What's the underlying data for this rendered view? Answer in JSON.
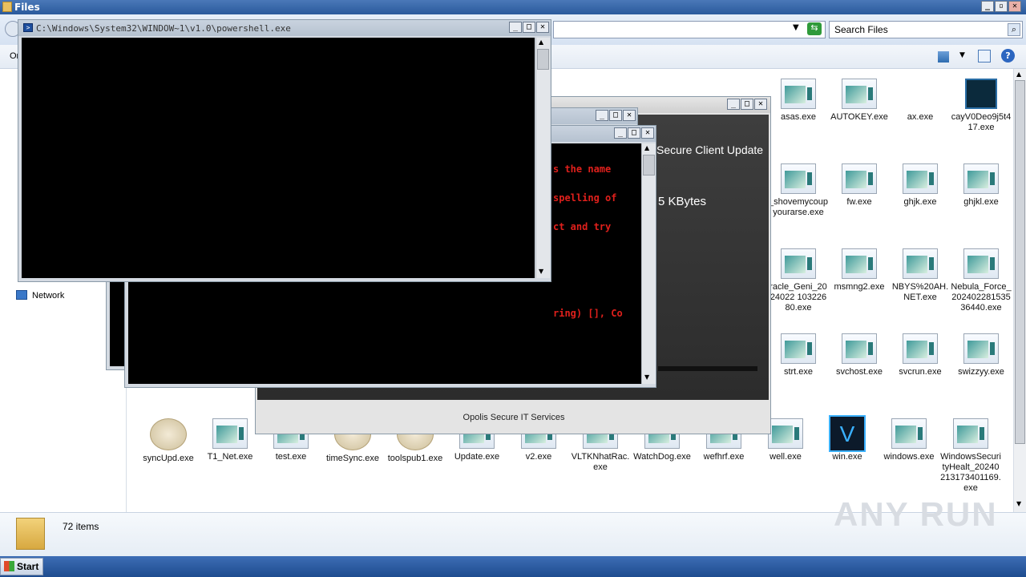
{
  "explorer": {
    "title": "Files",
    "search_placeholder": "Search Files",
    "address_value": "",
    "toolbar_left": "Or",
    "nav_network": "Network",
    "status_count": "72 items",
    "watermark": "ANY RUN"
  },
  "files": [
    {
      "name": "asas.exe",
      "icon": "exe"
    },
    {
      "name": "AUTOKEY.exe",
      "icon": "exe"
    },
    {
      "name": "ax.exe",
      "icon": "none"
    },
    {
      "name": "cayV0Deo9j5t417.exe",
      "icon": "terminal"
    },
    {
      "name": "_shovemycoupyourarse.exe",
      "icon": "exe"
    },
    {
      "name": "fw.exe",
      "icon": "exe"
    },
    {
      "name": "ghjk.exe",
      "icon": "exe"
    },
    {
      "name": "ghjkl.exe",
      "icon": "exe"
    },
    {
      "name": "racle_Geni_2024022 10322680.exe",
      "icon": "exe"
    },
    {
      "name": "msmng2.exe",
      "icon": "exe"
    },
    {
      "name": "NBYS%20AH.NET.exe",
      "icon": "exe"
    },
    {
      "name": "Nebula_Force_20240228153536440.exe",
      "icon": "exe"
    },
    {
      "name": "strt.exe",
      "icon": "exe"
    },
    {
      "name": "svchost.exe",
      "icon": "exe"
    },
    {
      "name": "svcrun.exe",
      "icon": "exe"
    },
    {
      "name": "swizzyy.exe",
      "icon": "exe"
    },
    {
      "name": "syncUpd.exe",
      "icon": "bubble"
    },
    {
      "name": "T1_Net.exe",
      "icon": "exe"
    },
    {
      "name": "test.exe",
      "icon": "exe"
    },
    {
      "name": "timeSync.exe",
      "icon": "bubble"
    },
    {
      "name": "toolspub1.exe",
      "icon": "bubble"
    },
    {
      "name": "Update.exe",
      "icon": "exe"
    },
    {
      "name": "v2.exe",
      "icon": "exe"
    },
    {
      "name": "VLTKNhatRac.exe",
      "icon": "exe"
    },
    {
      "name": "WatchDog.exe",
      "icon": "exe"
    },
    {
      "name": "wefhrf.exe",
      "icon": "exe"
    },
    {
      "name": "well.exe",
      "icon": "exe"
    },
    {
      "name": "win.exe",
      "icon": "v-logo"
    },
    {
      "name": "windows.exe",
      "icon": "exe"
    },
    {
      "name": "WindowsSecurityHealt_20240213173401169.exe",
      "icon": "exe"
    }
  ],
  "powershell": {
    "title": "C:\\Windows\\System32\\WINDOW~1\\v1.0\\powershell.exe"
  },
  "console2": {
    "lines": [
      "s the name",
      "spelling of",
      "ct and try",
      "",
      "",
      "ring) [], Co"
    ]
  },
  "opolis": {
    "heading": "Secure Client Update",
    "size_text": "5 KBytes",
    "footer": "Opolis Secure IT Services"
  },
  "taskbar": {
    "start_label": "Start"
  },
  "colors": {
    "console_error": "#e0201c",
    "titlebar": "#2a5a9c"
  }
}
